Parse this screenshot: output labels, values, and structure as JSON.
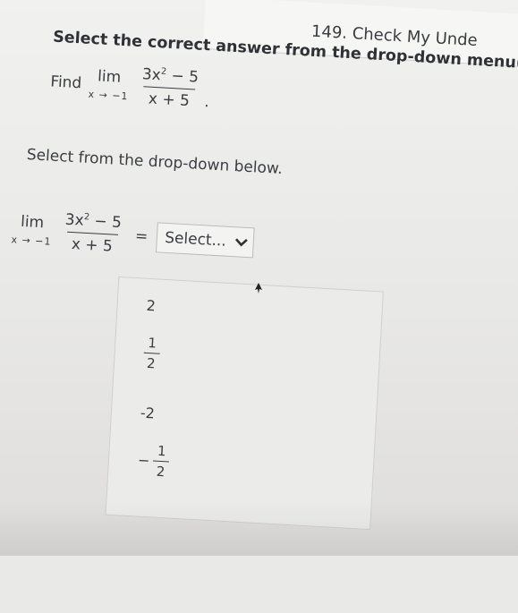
{
  "header": {
    "title": "149. Check My Unde"
  },
  "instruction": "Select the correct answer from the drop-down menu(s).",
  "problem": {
    "find": "Find",
    "lim": "lim",
    "lim_sub": "x → −1",
    "numerator": "3x",
    "exp": "2",
    "numerator_rest": " − 5",
    "denominator": "x + 5",
    "period": "."
  },
  "prompt": "Select from the drop-down below.",
  "equation": {
    "lim": "lim",
    "lim_sub": "x → −1",
    "numerator": "3x",
    "exp": "2",
    "numerator_rest": " − 5",
    "denominator": "x + 5",
    "equals": "="
  },
  "dropdown": {
    "selected": "Select...",
    "icon": "chevron-down-icon"
  },
  "options": [
    {
      "text": "2"
    },
    {
      "num": "1",
      "den": "2"
    },
    {
      "text": "-2"
    },
    {
      "sign": "−",
      "num": "1",
      "den": "2"
    }
  ]
}
